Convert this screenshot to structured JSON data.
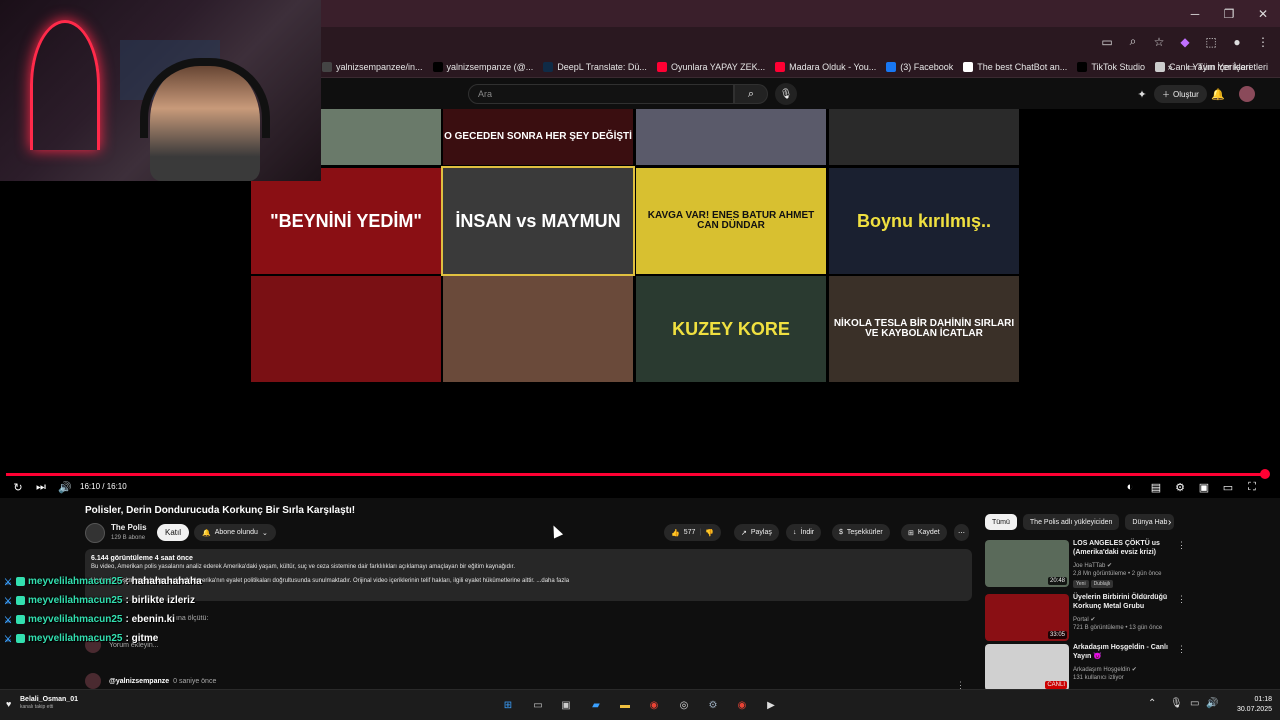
{
  "bookmarks": [
    {
      "label": "yalnizsempanzee/in...",
      "color": "#444444"
    },
    {
      "label": "yalnizsempanze (@...",
      "color": "#000000"
    },
    {
      "label": "DeepL Translate: Dü...",
      "color": "#0f2b46"
    },
    {
      "label": "Oyunlara YAPAY ZEK...",
      "color": "#ff0033"
    },
    {
      "label": "Madara Olduk - You...",
      "color": "#ff0033"
    },
    {
      "label": "(3) Facebook",
      "color": "#1877f2"
    },
    {
      "label": "The best ChatBot an...",
      "color": "#ffffff"
    },
    {
      "label": "TikTok Studio",
      "color": "#000000"
    },
    {
      "label": "Canlı Yayın İçerikleri",
      "color": "#cccccc"
    }
  ],
  "bookmarks_more": "»",
  "all_bookmarks": "Tüm Yer İşaretleri",
  "header": {
    "search_placeholder": "Ara",
    "create_label": "Oluştur"
  },
  "grid_thumbs": [
    {
      "text": "",
      "bg": "#6a7a6a"
    },
    {
      "text": "O GECEDEN SONRA HER ŞEY DEĞİŞTİ",
      "bg": "#3a0e10",
      "color": "#ffffff"
    },
    {
      "text": "",
      "bg": "#5a5a6a"
    },
    {
      "text": "",
      "bg": "#2a2a2a"
    },
    {
      "text": "\"BEYNİNİ YEDİM\"",
      "bg": "#8a0f14",
      "color": "#ffffff"
    },
    {
      "text": "İNSAN vs MAYMUN",
      "bg": "#3a3a3a",
      "color": "#ffffff"
    },
    {
      "text": "KAVGA VAR! ENES BATUR AHMET CAN DÜNDAR",
      "bg": "#d8c030",
      "color": "#111111"
    },
    {
      "text": "Boynu kırılmış..",
      "bg": "#1a2030",
      "color": "#f0e040"
    },
    {
      "text": "",
      "bg": "#7a1014"
    },
    {
      "text": "",
      "bg": "#6a4a3a"
    },
    {
      "text": "KUZEY KORE",
      "bg": "#2a3a30",
      "color": "#f0e040"
    },
    {
      "text": "NİKOLA TESLA BİR DAHİNİN SIRLARI VE KAYBOLAN İCATLAR",
      "bg": "#3a3028",
      "color": "#ffffff"
    }
  ],
  "player": {
    "timecode": "16:10 / 16:10"
  },
  "video": {
    "title": "Polisler, Derin Dondurucuda Korkunç Bir Sırla Karşılaştı!",
    "channel": "The Polis",
    "subs": "129 B abone",
    "join": "Katıl",
    "subscribed": "Abone olundu",
    "likes": "577",
    "share": "Paylaş",
    "download": "İndir",
    "thanks": "Teşekkürler",
    "save": "Kaydet",
    "desc_meta": "6.144 görüntüleme  4 saat önce",
    "desc_line1": "Bu video, Amerikan polis yasalarını analiz ederek Amerika'daki yaşam, kültür, suç ve ceza sistemine dair farklılıkları açıklamayı amaçlayan bir eğitim kaynağıdır.",
    "desc_line2": "Herkesin erişimine açık olan bu içerik, Amerika'nın eyalet politikaları doğrultusunda sunulmaktadır. Orijinal video içeriklerinin telif hakları, ilgili eyalet hükümetlerine aittir.  ...daha fazla",
    "comment_placeholder": "Yorum ekleyin...",
    "comment_sort": "ına ölçütü:",
    "comment_user": "@yalnizsempanze",
    "comment_time": "0 saniye önce"
  },
  "chat": [
    {
      "user": "meyvelilahmacun25",
      "msg": ": hahahahahaha"
    },
    {
      "user": "meyvelilahmacun25",
      "msg": ": birlikte izleriz"
    },
    {
      "user": "meyvelilahmacun25",
      "msg": ": ebenin.ki"
    },
    {
      "user": "meyvelilahmacun25",
      "msg": ": gitme"
    }
  ],
  "chips": [
    "Tümü",
    "The Polis adlı yükleyiciden",
    "Dünya Hab"
  ],
  "recommendations": [
    {
      "title": "LOS ANGELES ÇÖKTÜ us (Amerika'daki evsiz krizi)",
      "channel": "Joe HaTTab",
      "meta": "2,8 Mn görüntüleme • 2 gün önce",
      "tags": [
        "Yeni",
        "Dublajlı"
      ],
      "duration": "20:48",
      "bg": "#5a6a5a"
    },
    {
      "title": "Üyelerin Birbirini Öldürdüğü Korkunç Metal Grubu",
      "channel": "Portal",
      "meta": "721 B görüntüleme • 13 gün önce",
      "tags": [],
      "duration": "33:05",
      "bg": "#8a0f14"
    },
    {
      "title": "Arkadaşım Hoşgeldin - Canlı Yayın 😈",
      "channel": "Arkadaşım Hoşgeldin",
      "meta": "131 kullanıcı izliyor",
      "tags": [],
      "duration": "CANLI",
      "bg": "#d0d0d0"
    }
  ],
  "taskbar": {
    "follower_name": "Belali_Osman_01",
    "follower_text": "kanalı takip etti",
    "time": "01:18",
    "date": "30.07.2025"
  }
}
